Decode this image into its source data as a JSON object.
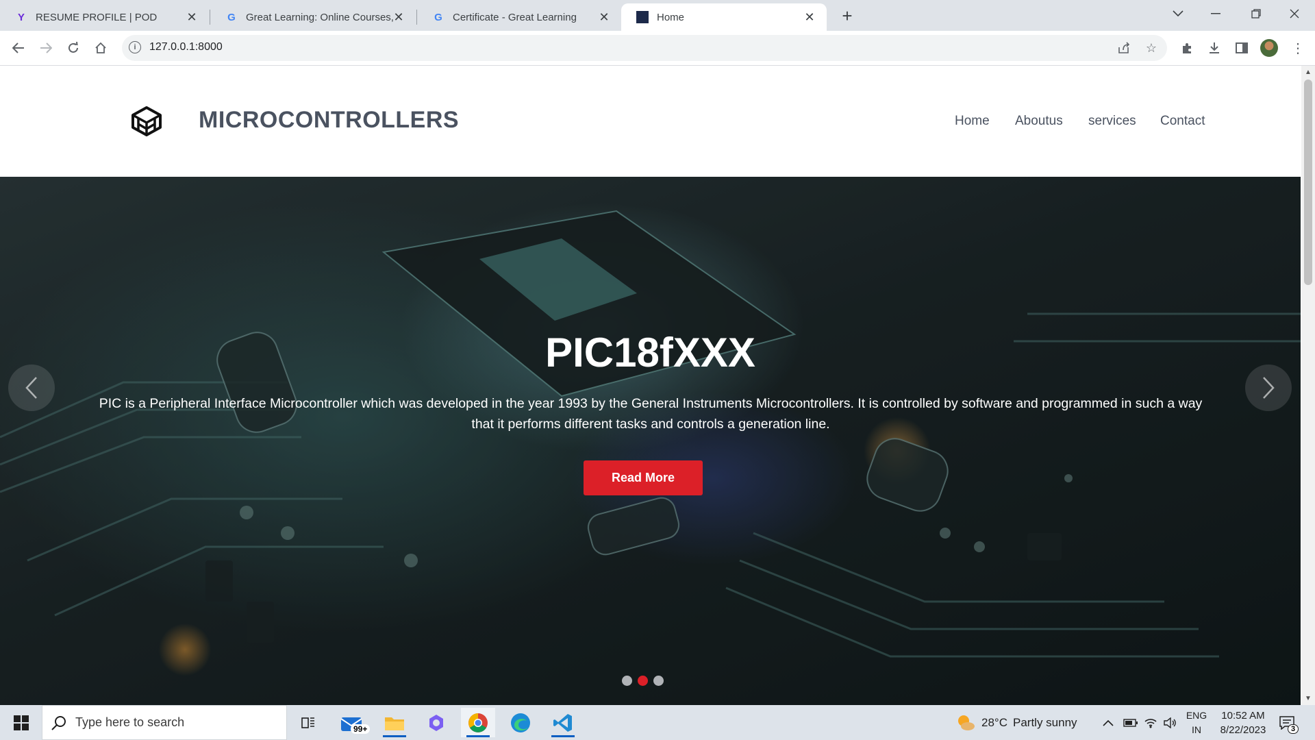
{
  "browser": {
    "tabs": [
      {
        "title": "RESUME PROFILE | POD",
        "icon": "pod-icon"
      },
      {
        "title": "Great Learning: Online Courses, F",
        "icon": "google-icon"
      },
      {
        "title": "Certificate - Great Learning",
        "icon": "google-icon"
      },
      {
        "title": "Home",
        "icon": "site-favicon"
      }
    ],
    "url": "127.0.0.1:8000"
  },
  "site": {
    "brand": "MICROCONTROLLERS",
    "nav": [
      "Home",
      "Aboutus",
      "services",
      "Contact"
    ],
    "hero": {
      "title": "PIC18fXXX",
      "text": "PIC is a Peripheral Interface Microcontroller which was developed in the year 1993 by the General Instruments Microcontrollers. It is controlled by software and programmed in such a way that it performs different tasks and controls a generation line.",
      "button": "Read More",
      "slides_total": 3,
      "active_slide": 2
    },
    "colors": {
      "accent": "#dc2028",
      "text": "#4a5260"
    }
  },
  "taskbar": {
    "search_placeholder": "Type here to search",
    "mail_badge": "99+",
    "weather_temp": "28°C",
    "weather_desc": "Partly sunny",
    "lang_line1": "ENG",
    "lang_line2": "IN",
    "time": "10:52 AM",
    "date": "8/22/2023",
    "notifications": "3"
  }
}
